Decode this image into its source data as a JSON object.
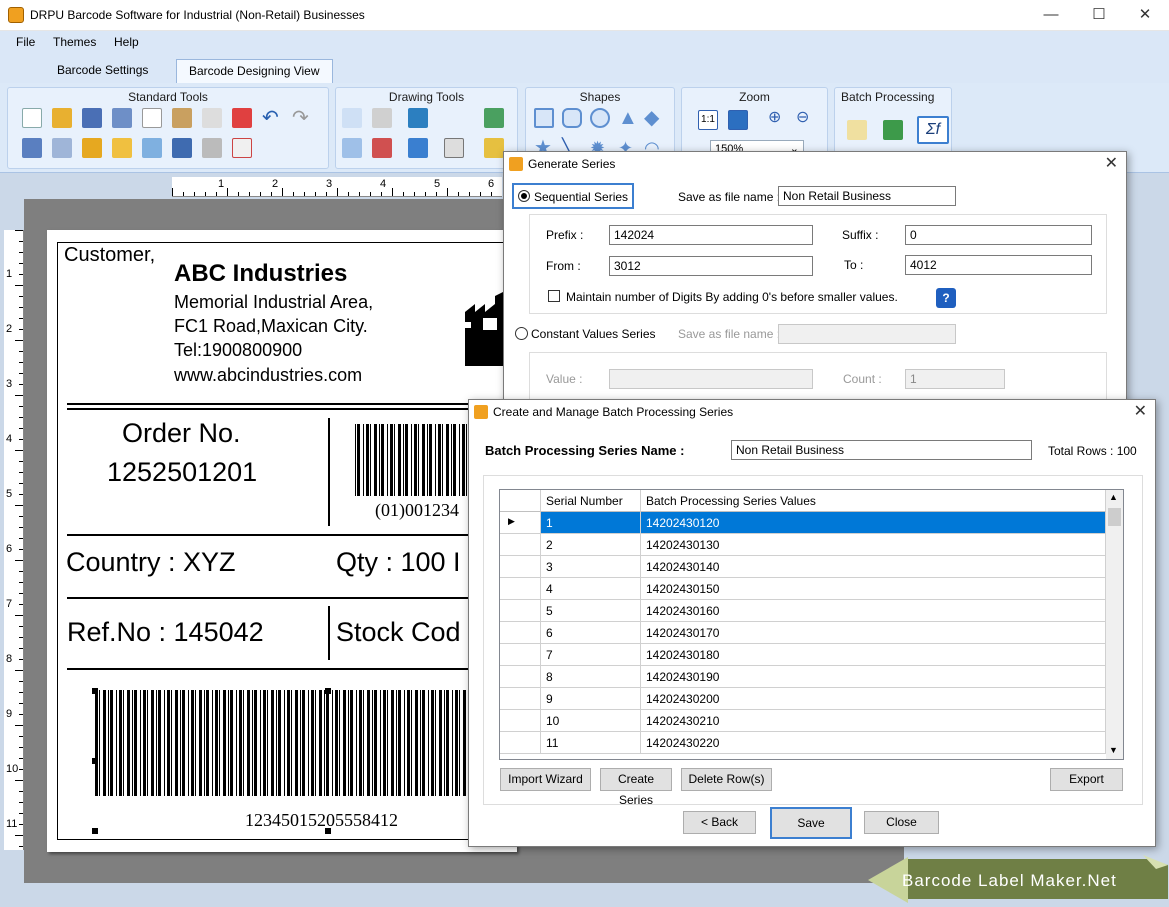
{
  "window": {
    "title": "DRPU Barcode Software for Industrial (Non-Retail) Businesses",
    "min": "—",
    "max": "☐",
    "close": "✕"
  },
  "menu": [
    "File",
    "Themes",
    "Help"
  ],
  "tabs": [
    "Barcode Settings",
    "Barcode Designing View"
  ],
  "ribbon": {
    "groups": [
      "Standard Tools",
      "Drawing Tools",
      "Shapes",
      "Zoom",
      "Batch Processing"
    ],
    "zoom_value": "150%"
  },
  "label": {
    "customer": "Customer,",
    "company": "ABC Industries",
    "addr1": "Memorial Industrial Area,",
    "addr2": "FC1 Road,Maxican City.",
    "tel": "Tel:1900800900",
    "web": "www.abcindustries.com",
    "order_title": "Order No.",
    "order_no": "1252501201",
    "barcode1_text": "(01)001234",
    "country": "Country : XYZ",
    "qty": "Qty : 100 I",
    "ref": "Ref.No : 145042",
    "stock": "Stock Cod",
    "barcode2_text": "12345015205558412"
  },
  "generate": {
    "title": "Generate Series",
    "sequential": "Sequential Series",
    "save_as_label": "Save as file name :",
    "save_as_value": "Non Retail Business",
    "prefix_label": "Prefix :",
    "prefix": "142024",
    "suffix_label": "Suffix :",
    "suffix": "0",
    "from_label": "From :",
    "from": "3012",
    "to_label": "To :",
    "to": "4012",
    "maintain": "Maintain number of Digits By adding 0's before smaller values.",
    "help": "?",
    "constant": "Constant Values Series",
    "save_as_label2": "Save as file name :",
    "value_label": "Value :",
    "count_label": "Count :",
    "count": "1"
  },
  "batch": {
    "title": "Create and Manage Batch Processing Series",
    "name_label": "Batch Processing Series Name :",
    "name_value": "Non Retail Business",
    "total_rows": "Total Rows : 100",
    "col_serial": "Serial Number",
    "col_values": "Batch Processing Series Values",
    "rows": [
      [
        "1",
        "14202430120"
      ],
      [
        "2",
        "14202430130"
      ],
      [
        "3",
        "14202430140"
      ],
      [
        "4",
        "14202430150"
      ],
      [
        "5",
        "14202430160"
      ],
      [
        "6",
        "14202430170"
      ],
      [
        "7",
        "14202430180"
      ],
      [
        "8",
        "14202430190"
      ],
      [
        "9",
        "14202430200"
      ],
      [
        "10",
        "14202430210"
      ],
      [
        "11",
        "14202430220"
      ]
    ],
    "import": "Import Wizard",
    "create": "Create Series",
    "delete": "Delete Row(s)",
    "export": "Export",
    "back": "< Back",
    "save": "Save",
    "close": "Close"
  },
  "watermark": "Barcode Label Maker.Net",
  "rulers": {
    "h": [
      "1",
      "2",
      "3",
      "4",
      "5",
      "6"
    ],
    "v": [
      "1",
      "2",
      "3",
      "4",
      "5",
      "6",
      "7",
      "8",
      "9",
      "10",
      "11"
    ]
  }
}
